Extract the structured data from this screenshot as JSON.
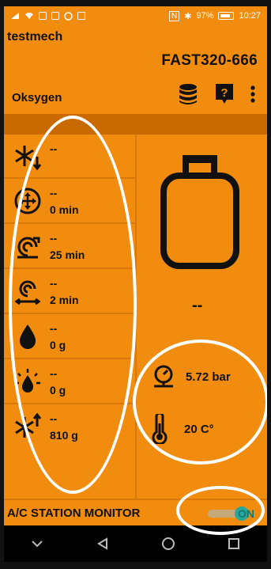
{
  "status_bar": {
    "battery": "97%",
    "time": "10:27",
    "icons": [
      "signal-icon",
      "wifi-icon",
      "image-icon",
      "mail-icon",
      "whatsapp-icon",
      "nfc-icon",
      "bluetooth-icon",
      "battery-icon"
    ]
  },
  "header": {
    "user": "testmech",
    "device": "FAST320-666",
    "gas": "Oksygen",
    "icons": [
      "database-icon",
      "help-icon",
      "more-vert-icon"
    ]
  },
  "readings": [
    {
      "icon": "snowflake-down-icon",
      "value": "--",
      "sub": ""
    },
    {
      "icon": "fan-arrows-icon",
      "value": "--",
      "sub": "0 min"
    },
    {
      "icon": "pump-vacuum-icon",
      "value": "--",
      "sub": "25 min"
    },
    {
      "icon": "spiral-compress-icon",
      "value": "--",
      "sub": "2 min"
    },
    {
      "icon": "oil-drop-icon",
      "value": "--",
      "sub": "0 g"
    },
    {
      "icon": "uv-drop-icon",
      "value": "--",
      "sub": "0 g"
    },
    {
      "icon": "snowflake-up-icon",
      "value": "--",
      "sub": "810 g"
    }
  ],
  "tank": {
    "icon": "gas-bottle-icon",
    "value": "--"
  },
  "measurements": {
    "pressure": {
      "icon": "pressure-gauge-icon",
      "value": "5.72 bar"
    },
    "temperature": {
      "icon": "thermometer-icon",
      "value": "20 C°"
    }
  },
  "monitor": {
    "label": "A/C STATION MONITOR",
    "toggle": "ON"
  },
  "colors": {
    "background": "#f28c0f",
    "divider": "#c86a00",
    "toggle_on": "#2aa79a"
  }
}
